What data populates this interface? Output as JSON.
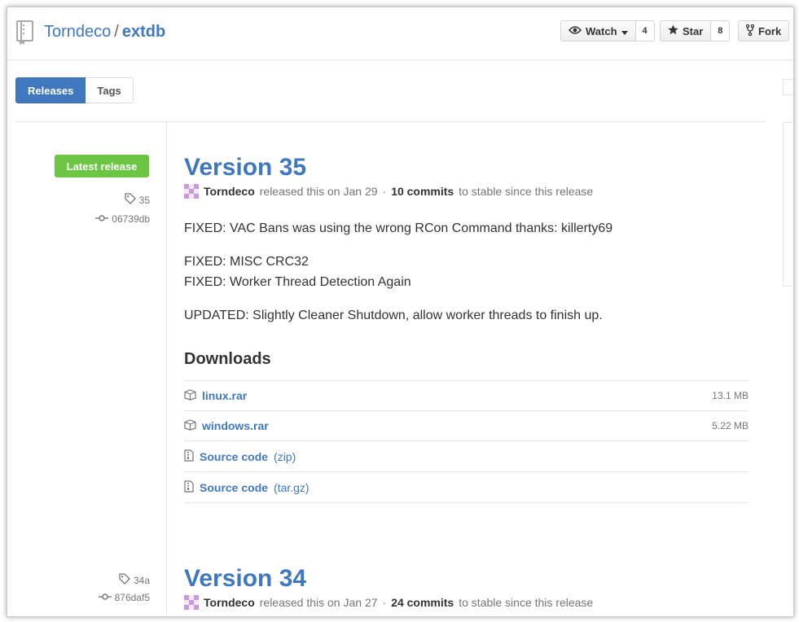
{
  "repo": {
    "owner": "Torndeco",
    "separator": "/",
    "name": "extdb"
  },
  "actions": {
    "watch_label": "Watch",
    "watch_count": "4",
    "star_label": "Star",
    "star_count": "8",
    "fork_label": "Fork"
  },
  "tabs": [
    {
      "label": "Releases",
      "active": true
    },
    {
      "label": "Tags",
      "active": false
    }
  ],
  "releases": [
    {
      "badge": "Latest release",
      "tag": "35",
      "commit": "06739db",
      "title": "Version 35",
      "author": "Torndeco",
      "released_text": "released this on Jan 29",
      "dot": "·",
      "commits": "10 commits",
      "commits_suffix": "to stable since this release",
      "notes": [
        "FIXED: VAC Bans was using the wrong RCon Command thanks: killerty69",
        "FIXED: MISC CRC32",
        "FIXED: Worker Thread Detection Again",
        "UPDATED: Slightly Cleaner Shutdown, allow worker threads to finish up."
      ],
      "downloads_title": "Downloads",
      "downloads": [
        {
          "name": "linux.rar",
          "size": "13.1 MB",
          "icon": "package-icon"
        },
        {
          "name": "windows.rar",
          "size": "5.22 MB",
          "icon": "package-icon"
        },
        {
          "name": "Source code",
          "ext": "(zip)",
          "icon": "file-zip-icon"
        },
        {
          "name": "Source code",
          "ext": "(tar.gz)",
          "icon": "file-zip-icon"
        }
      ]
    },
    {
      "tag": "34a",
      "commit": "876daf5",
      "title": "Version 34",
      "author": "Torndeco",
      "released_text": "released this on Jan 27",
      "dot": "·",
      "commits": "24 commits",
      "commits_suffix": "to stable since this release"
    }
  ],
  "colors": {
    "link": "#4078c0",
    "latest_badge": "#6cc644",
    "muted": "#767676"
  }
}
